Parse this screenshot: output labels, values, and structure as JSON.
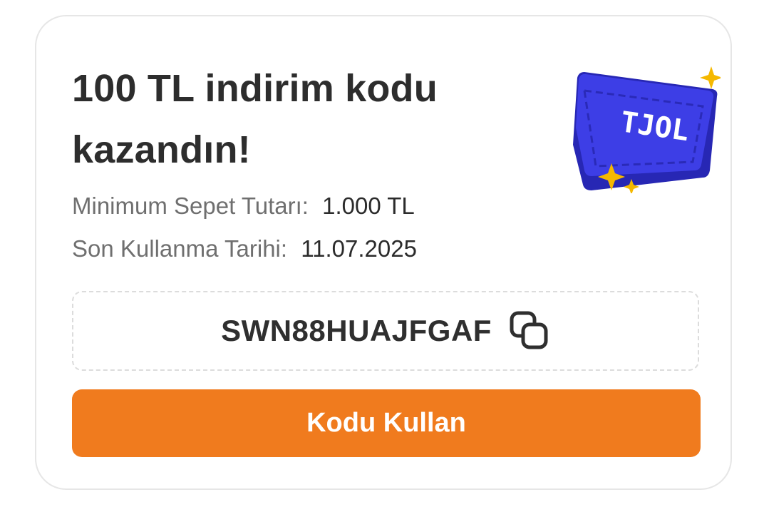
{
  "reward": {
    "title": "100 TL indirim kodu kazandın!",
    "min_basket_label": "Minimum Sepet Tutarı:",
    "min_basket_value": "1.000 TL",
    "expiry_label": "Son Kullanma Tarihi:",
    "expiry_value": "11.07.2025",
    "code": "SWN88HUAJFGAF",
    "cta_label": "Kodu Kullan"
  },
  "illustration": {
    "icon": "coupon-ticket-icon",
    "ticket_text": "TJOL",
    "colors": {
      "ticket_face": "#3d3ee6",
      "ticket_side": "#2727b4",
      "sparkle": "#f5b800"
    }
  },
  "icons": {
    "copy": "copy-icon"
  },
  "colors": {
    "accent": "#f07b1e",
    "title": "#2d2d2d",
    "label": "#6f6f6f",
    "card_border": "#e6e6e6"
  }
}
